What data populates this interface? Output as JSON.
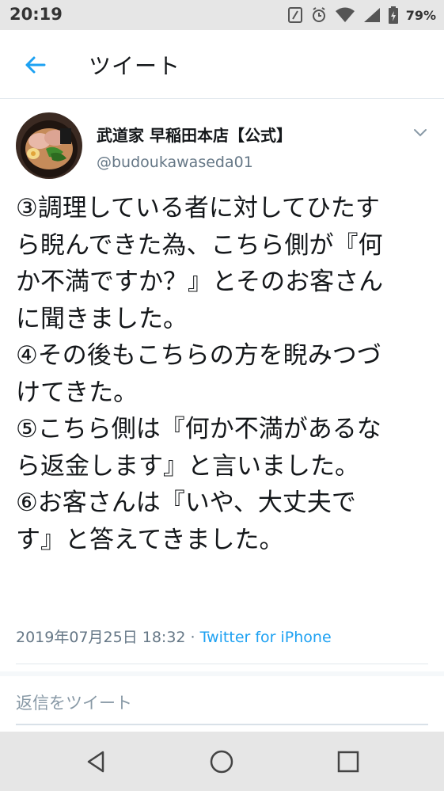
{
  "status_bar": {
    "time": "20:19",
    "battery_percent": "79%",
    "icons": [
      "nfc-icon",
      "alarm-icon",
      "wifi-icon",
      "signal-icon",
      "battery-icon"
    ]
  },
  "header": {
    "title": "ツイート"
  },
  "tweet": {
    "author_name": "武道家 早稲田本店【公式】",
    "handle": "@budoukawaseda01",
    "lines": [
      "③調理している者に対してひたす",
      "ら睨んできた為、こちら側が『何",
      "か不満ですか？』とそのお客さん",
      "に聞きました。",
      "④その後もこちらの方を睨みつづ",
      "けてきた。",
      "⑤こちら側は『何か不満があるな",
      "ら返金します』と言いました。",
      "⑥お客さんは『いや、大丈夫で",
      "す』と答えてきました。"
    ],
    "timestamp": "2019年07月25日 18:32",
    "separator": " · ",
    "source": "Twitter for iPhone"
  },
  "reply": {
    "placeholder": "返信をツイート"
  },
  "colors": {
    "link_blue": "#1da1f2",
    "secondary_text": "#657786",
    "primary_text": "#14171a"
  }
}
